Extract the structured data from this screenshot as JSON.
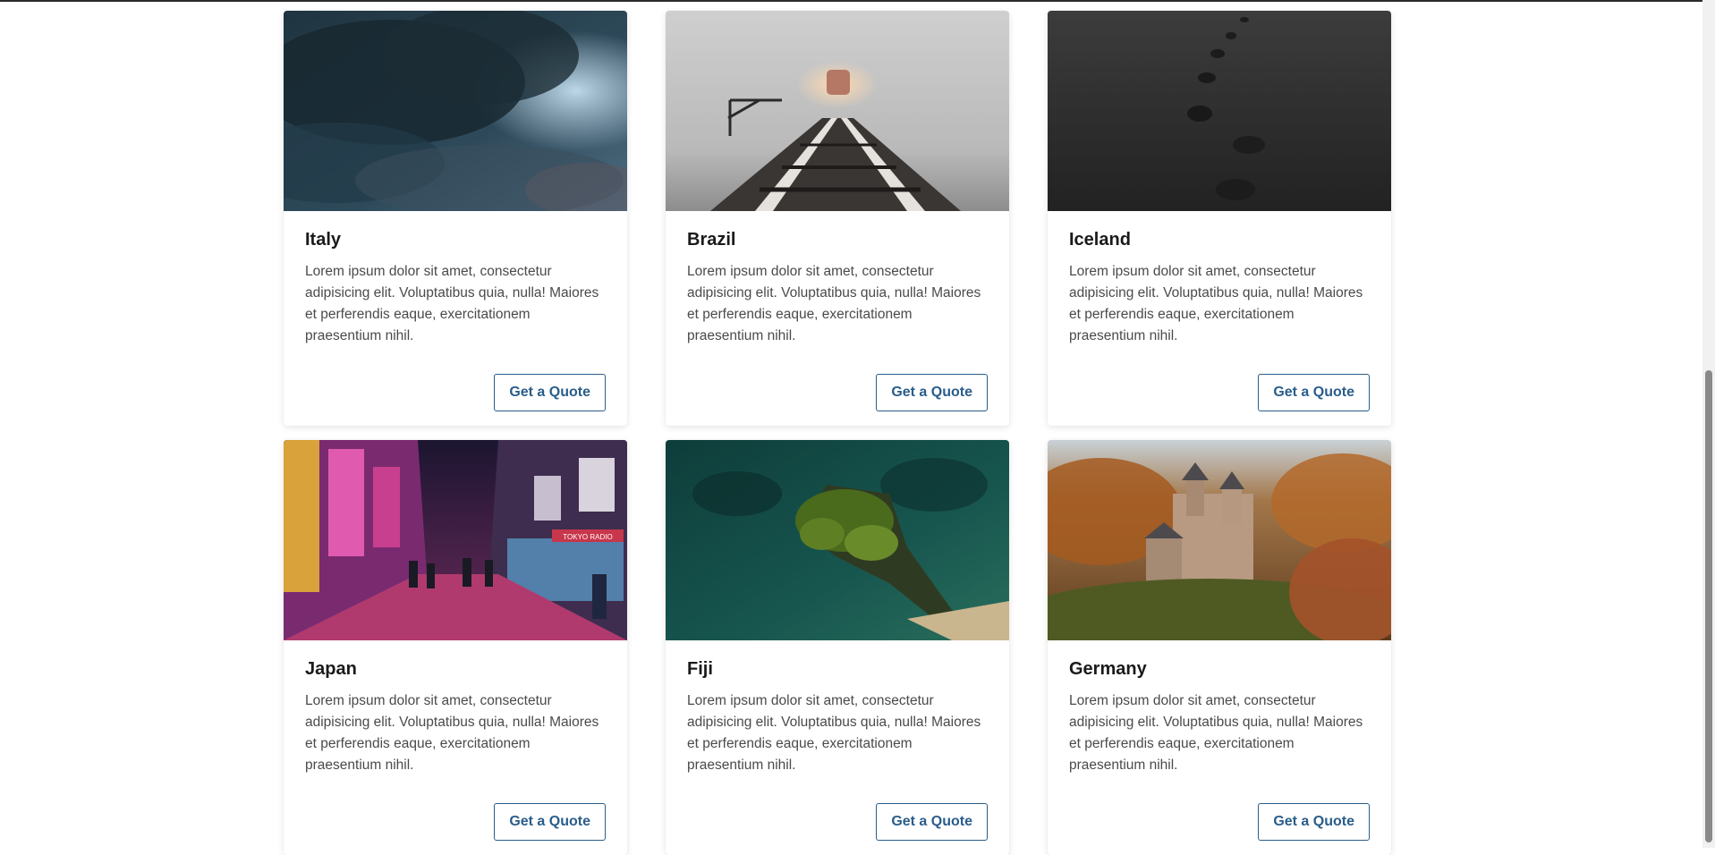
{
  "cards": [
    {
      "title": "Italy",
      "text": "Lorem ipsum dolor sit amet, consectetur adipisicing elit. Voluptatibus quia, nulla! Maiores et perferendis eaque, exercitationem praesentium nihil.",
      "button_label": "Get a Quote",
      "image": "stormy-clouds"
    },
    {
      "title": "Brazil",
      "text": "Lorem ipsum dolor sit amet, consectetur adipisicing elit. Voluptatibus quia, nulla! Maiores et perferendis eaque, exercitationem praesentium nihil.",
      "button_label": "Get a Quote",
      "image": "foggy-railway"
    },
    {
      "title": "Iceland",
      "text": "Lorem ipsum dolor sit amet, consectetur adipisicing elit. Voluptatibus quia, nulla! Maiores et perferendis eaque, exercitationem praesentium nihil.",
      "button_label": "Get a Quote",
      "image": "footprints-gravel"
    },
    {
      "title": "Japan",
      "text": "Lorem ipsum dolor sit amet, consectetur adipisicing elit. Voluptatibus quia, nulla! Maiores et perferendis eaque, exercitationem praesentium nihil.",
      "button_label": "Get a Quote",
      "image": "neon-street",
      "sign_text": "TOKYO RADIO"
    },
    {
      "title": "Fiji",
      "text": "Lorem ipsum dolor sit amet, consectetur adipisicing elit. Voluptatibus quia, nulla! Maiores et perferendis eaque, exercitationem praesentium nihil.",
      "button_label": "Get a Quote",
      "image": "tropical-island"
    },
    {
      "title": "Germany",
      "text": "Lorem ipsum dolor sit amet, consectetur adipisicing elit. Voluptatibus quia, nulla! Maiores et perferendis eaque, exercitationem praesentium nihil.",
      "button_label": "Get a Quote",
      "image": "castle-forest"
    }
  ],
  "colors": {
    "accent": "#2a5d8a",
    "title": "#1a1a1a",
    "body_text": "#4a4a4a"
  }
}
